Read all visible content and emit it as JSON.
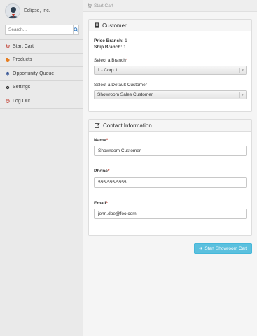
{
  "sidebar": {
    "company": "Eclipse, Inc.",
    "search_placeholder": "Search...",
    "items": [
      {
        "label": "Start Cart",
        "icon": "cart-icon",
        "color": "#c0392b"
      },
      {
        "label": "Products",
        "icon": "tags-icon",
        "color": "#e67e22"
      },
      {
        "label": "Opportunity Queue",
        "icon": "bell-icon",
        "color": "#3b5998"
      },
      {
        "label": "Settings",
        "icon": "gear-icon",
        "color": "#333333"
      },
      {
        "label": "Log Out",
        "icon": "power-icon",
        "color": "#c0392b"
      }
    ]
  },
  "breadcrumb": {
    "label": "Start Cart"
  },
  "customer_panel": {
    "title": "Customer",
    "price_branch_label": "Price Branch:",
    "price_branch_value": "1",
    "ship_branch_label": "Ship Branch:",
    "ship_branch_value": "1",
    "branch_label": "Select a Branch",
    "branch_required": "*",
    "branch_value": "1 - Corp 1",
    "default_customer_label": "Select a Default Customer",
    "default_customer_value": "Showroom Sales Customer"
  },
  "contact_panel": {
    "title": "Contact Information",
    "name_label": "Name",
    "name_required": "*",
    "name_value": "Showroom Customer",
    "phone_label": "Phone",
    "phone_required": "*",
    "phone_value": "555-555-5555",
    "email_label": "Email",
    "email_required": "*",
    "email_value": "john.doe@foo.com"
  },
  "submit": {
    "label": "Start Showroom Cart"
  },
  "colors": {
    "accent": "#5bc0de",
    "required": "#c0392b"
  }
}
